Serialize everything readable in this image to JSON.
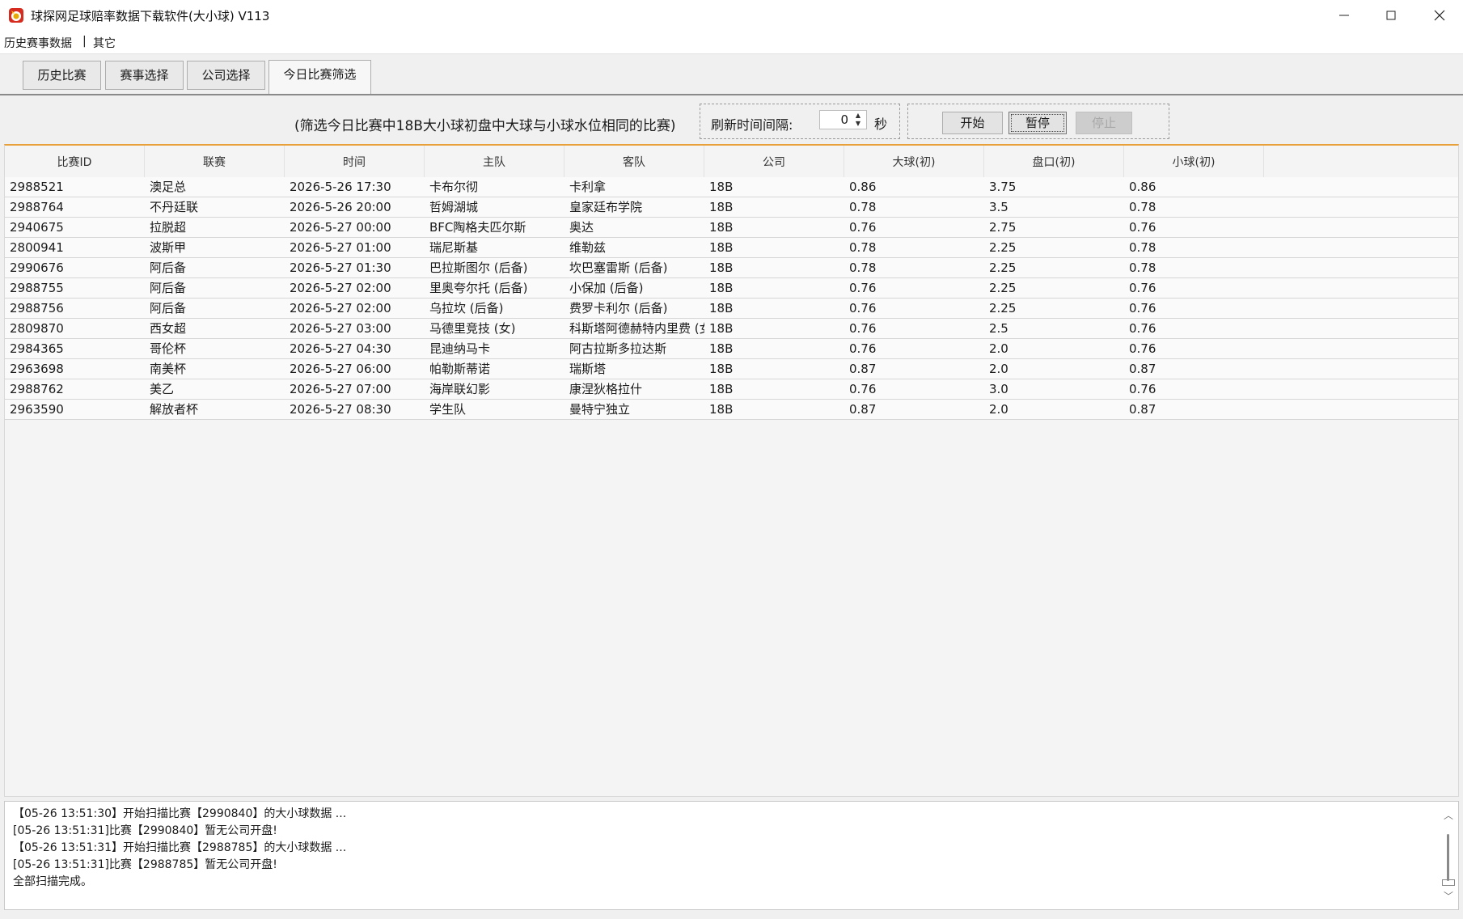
{
  "window": {
    "title": "球探网足球赔率数据下载软件(大小球) V113",
    "app_icon": "app-logo-icon",
    "controls": [
      "minimize-icon",
      "maximize-icon",
      "close-icon"
    ]
  },
  "menu": {
    "history": "历史赛事数据",
    "separator": "|",
    "other": "其它"
  },
  "tabs": [
    "历史比赛",
    "赛事选择",
    "公司选择",
    "今日比赛筛选"
  ],
  "active_tab": 3,
  "filter": {
    "description": "(筛选今日比赛中18B大小球初盘中大球与小球水位相同的比赛)",
    "refresh_label": "刷新时间间隔:",
    "refresh_value": "0",
    "unit": "秒",
    "start_label": "开始",
    "pause_label": "暂停",
    "stop_label": "停止"
  },
  "table": {
    "columns": [
      "比赛ID",
      "联赛",
      "时间",
      "主队",
      "客队",
      "公司",
      "大球(初)",
      "盘口(初)",
      "小球(初)"
    ],
    "rows": [
      [
        "2988521",
        "澳足总",
        "2026-5-26 17:30",
        "卡布尔彻",
        "卡利拿",
        "18B",
        "0.86",
        "3.75",
        "0.86"
      ],
      [
        "2988764",
        "不丹廷联",
        "2026-5-26 20:00",
        "哲姆湖城",
        "皇家廷布学院",
        "18B",
        "0.78",
        "3.5",
        "0.78"
      ],
      [
        "2940675",
        "拉脱超",
        "2026-5-27 00:00",
        "BFC陶格夫匹尔斯",
        "奥达",
        "18B",
        "0.76",
        "2.75",
        "0.76"
      ],
      [
        "2800941",
        "波斯甲",
        "2026-5-27 01:00",
        "瑞尼斯基",
        "维勒兹",
        "18B",
        "0.78",
        "2.25",
        "0.78"
      ],
      [
        "2990676",
        "阿后备",
        "2026-5-27 01:30",
        "巴拉斯图尔 (后备)",
        "坎巴塞雷斯 (后备)",
        "18B",
        "0.78",
        "2.25",
        "0.78"
      ],
      [
        "2988755",
        "阿后备",
        "2026-5-27 02:00",
        "里奥夸尔托 (后备)",
        "小保加 (后备)",
        "18B",
        "0.76",
        "2.25",
        "0.76"
      ],
      [
        "2988756",
        "阿后备",
        "2026-5-27 02:00",
        "乌拉坎 (后备)",
        "费罗卡利尔 (后备)",
        "18B",
        "0.76",
        "2.25",
        "0.76"
      ],
      [
        "2809870",
        "西女超",
        "2026-5-27 03:00",
        "马德里竞技 (女)",
        "科斯塔阿德赫特内里费 (女)",
        "18B",
        "0.76",
        "2.5",
        "0.76"
      ],
      [
        "2984365",
        "哥伦杯",
        "2026-5-27 04:30",
        "昆迪纳马卡",
        "阿古拉斯多拉达斯",
        "18B",
        "0.76",
        "2.0",
        "0.76"
      ],
      [
        "2963698",
        "南美杯",
        "2026-5-27 06:00",
        "帕勒斯蒂诺",
        "瑞斯塔",
        "18B",
        "0.87",
        "2.0",
        "0.87"
      ],
      [
        "2988762",
        "美乙",
        "2026-5-27 07:00",
        "海岸联幻影",
        "康涅狄格拉什",
        "18B",
        "0.76",
        "3.0",
        "0.76"
      ],
      [
        "2963590",
        "解放者杯",
        "2026-5-27 08:30",
        "学生队",
        "曼特宁独立",
        "18B",
        "0.87",
        "2.0",
        "0.87"
      ]
    ]
  },
  "log": [
    "【05-26 13:51:30】开始扫描比赛【2990840】的大小球数据 ...",
    "[05-26 13:51:31]比赛【2990840】暂无公司开盘!",
    "【05-26 13:51:31】开始扫描比赛【2988785】的大小球数据 ...",
    "[05-26 13:51:31]比赛【2988785】暂无公司开盘!",
    "全部扫描完成。"
  ],
  "colors": {
    "accent_line": "#e8a13a",
    "icon_red": "#d62b1f"
  }
}
